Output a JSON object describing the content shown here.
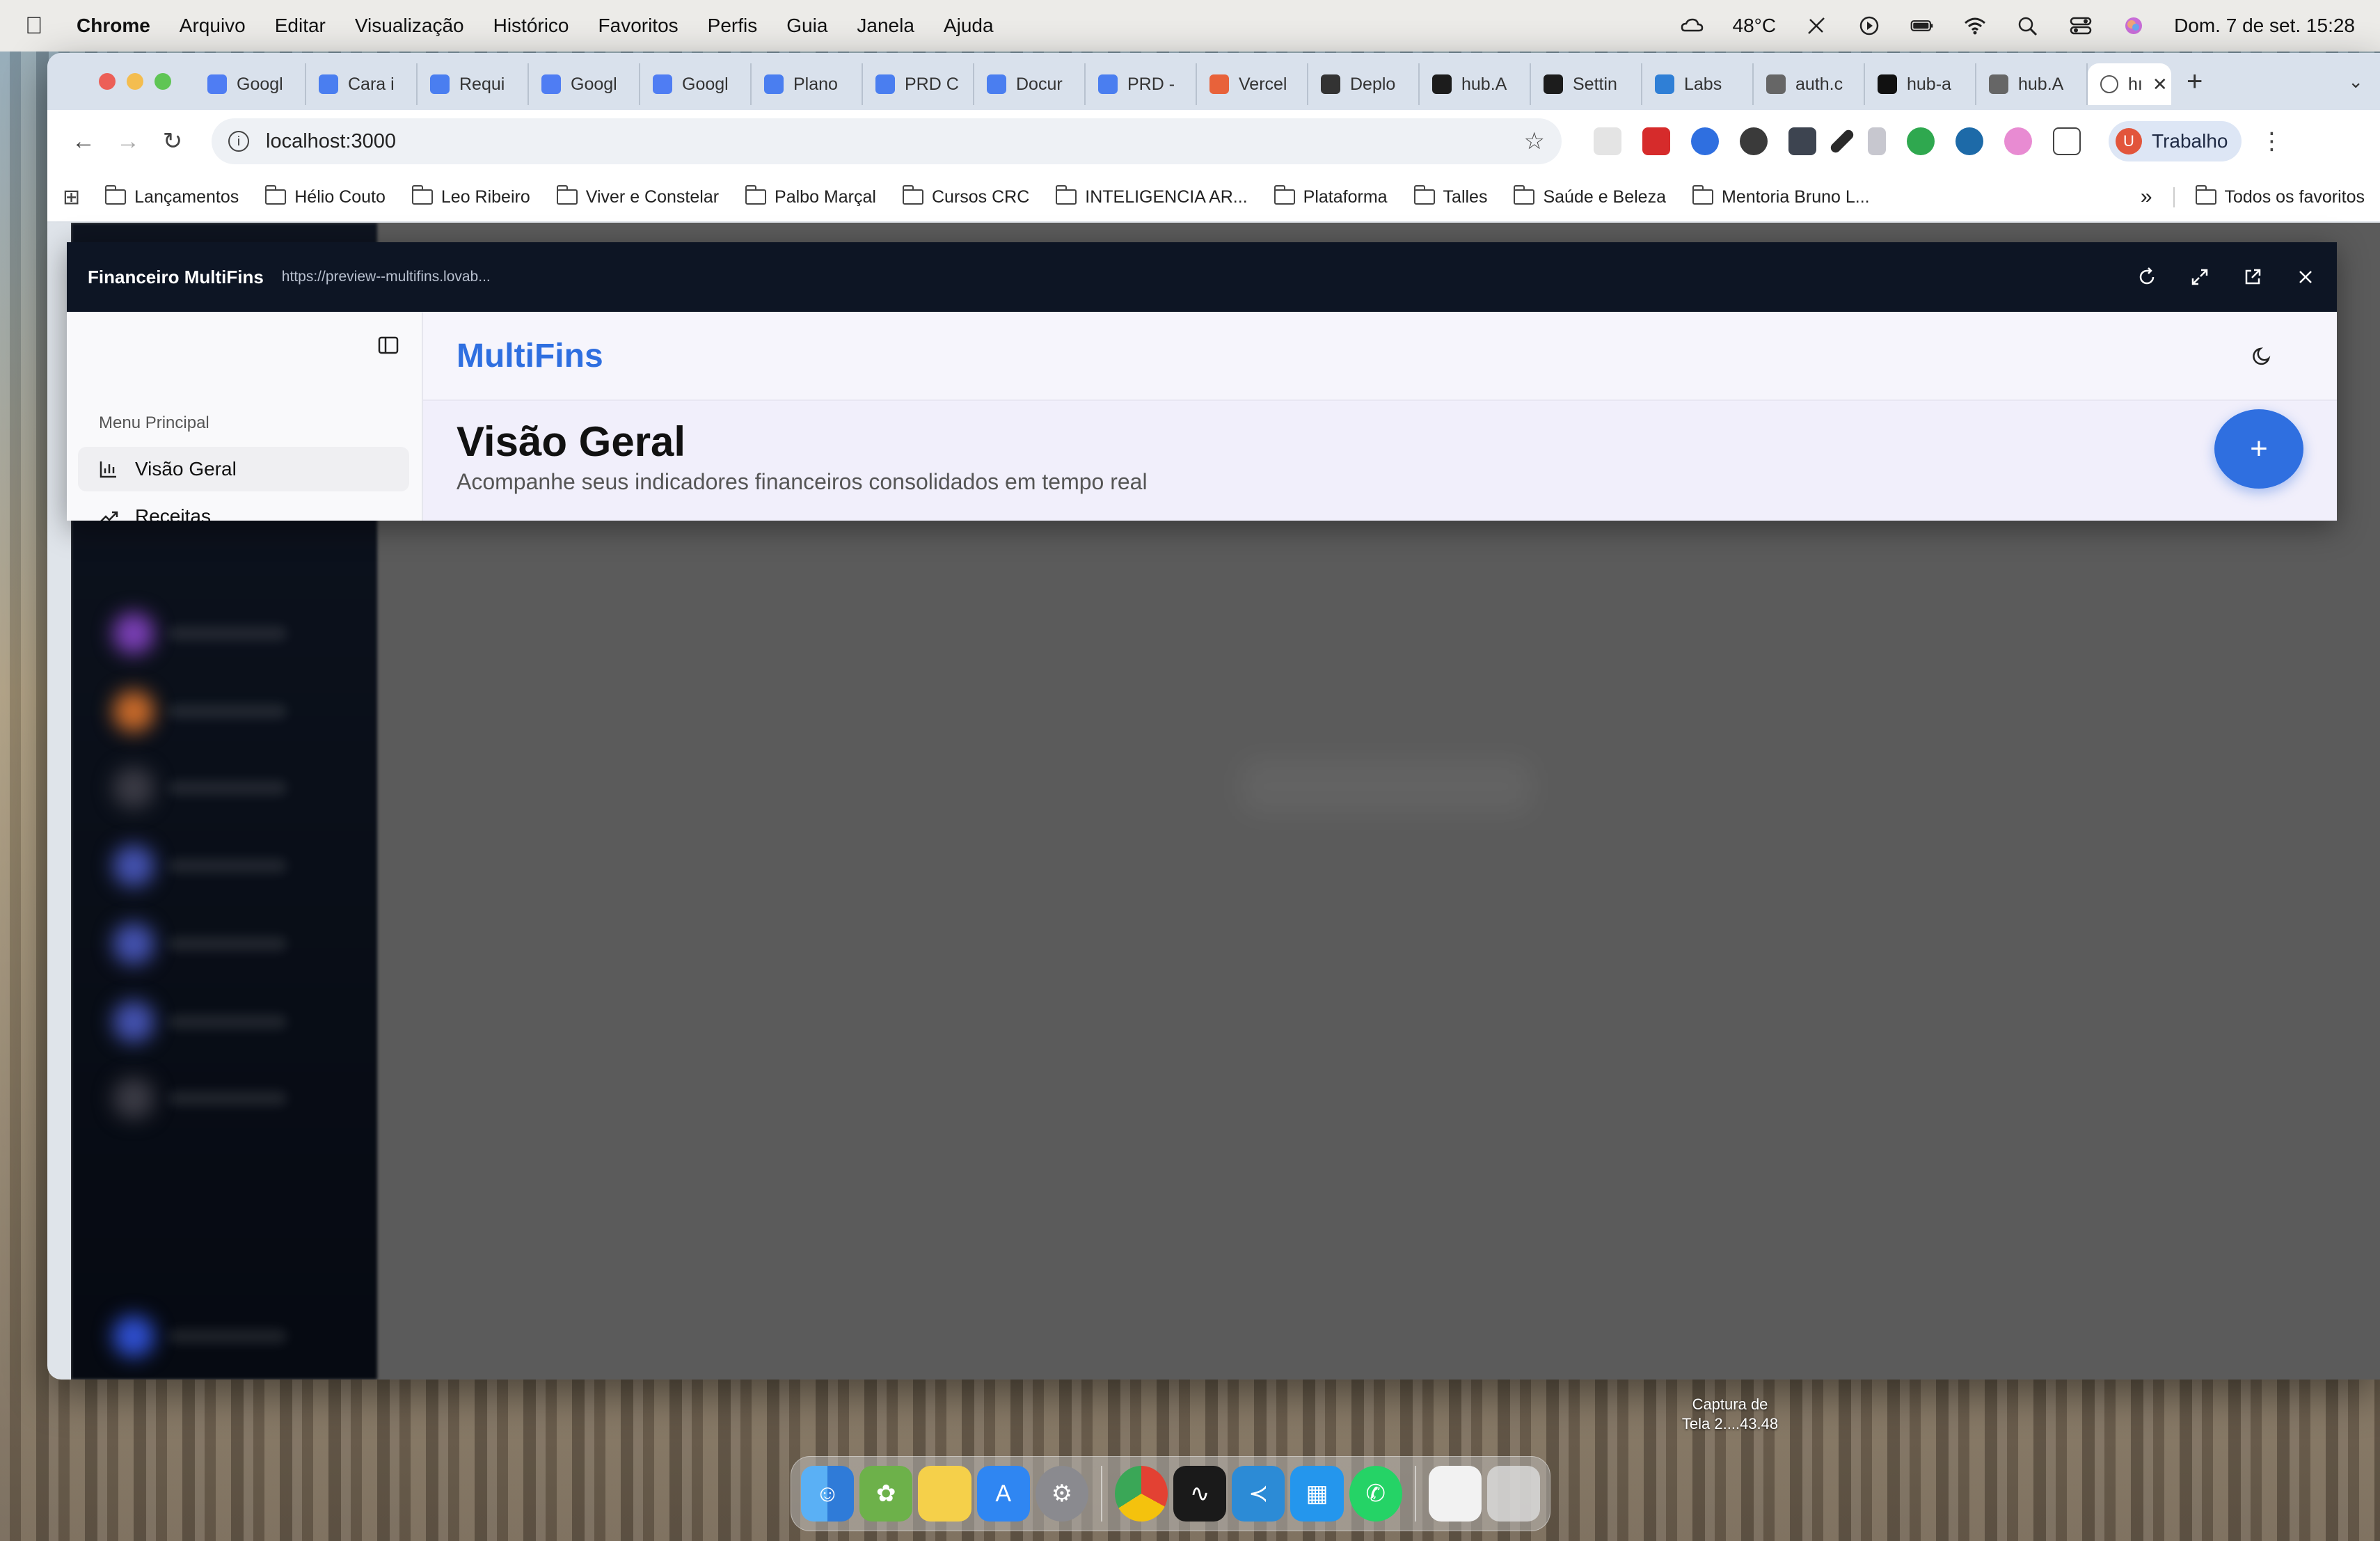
{
  "menubar": {
    "app": "Chrome",
    "items": [
      "Arquivo",
      "Editar",
      "Visualização",
      "Histórico",
      "Favoritos",
      "Perfis",
      "Guia",
      "Janela",
      "Ajuda"
    ],
    "temperature": "48°C",
    "datetime": "Dom. 7 de set.  15:28"
  },
  "tabs": [
    {
      "label": "Googl",
      "icon": "gemini-icon",
      "color": "#4f7df3"
    },
    {
      "label": "Cara i",
      "icon": "docs-icon",
      "color": "#4a7ef0"
    },
    {
      "label": "Requi",
      "icon": "docs-icon",
      "color": "#4a7ef0"
    },
    {
      "label": "Googl",
      "icon": "gemini-icon",
      "color": "#4f7df3"
    },
    {
      "label": "Googl",
      "icon": "gemini-icon",
      "color": "#4f7df3"
    },
    {
      "label": "Plano",
      "icon": "docs-icon",
      "color": "#4a7ef0"
    },
    {
      "label": "PRD C",
      "icon": "docs-icon",
      "color": "#4a7ef0"
    },
    {
      "label": "Docur",
      "icon": "docs-icon",
      "color": "#4a7ef0"
    },
    {
      "label": "PRD -",
      "icon": "docs-icon",
      "color": "#4a7ef0"
    },
    {
      "label": "Vercel",
      "icon": "spark-icon",
      "color": "#e8623a"
    },
    {
      "label": "Deplo",
      "icon": "robot-icon",
      "color": "#333333"
    },
    {
      "label": "hub.A",
      "icon": "pulse-icon",
      "color": "#1c1c1c"
    },
    {
      "label": "Settin",
      "icon": "pulse-icon",
      "color": "#1c1c1c"
    },
    {
      "label": "Labs",
      "icon": "docker-icon",
      "color": "#2f7fd6"
    },
    {
      "label": "auth.c",
      "icon": "globe-icon",
      "color": "#666666"
    },
    {
      "label": "hub-a",
      "icon": "triangle-icon",
      "color": "#111111"
    },
    {
      "label": "hub.A",
      "icon": "globe-icon",
      "color": "#666666"
    }
  ],
  "active_tab": {
    "label": "hı",
    "icon": "globe-icon"
  },
  "address": {
    "url": "localhost:3000"
  },
  "profile": {
    "initial": "U",
    "label": "Trabalho"
  },
  "bookmarks": [
    "Lançamentos",
    "Hélio Couto",
    "Leo Ribeiro",
    "Viver e Constelar",
    "Palbo Marçal",
    "Cursos CRC",
    "INTELIGENCIA AR...",
    "Plataforma",
    "Talles",
    "Saúde e Beleza",
    "Mentoria Bruno L..."
  ],
  "bookmarks_all": "Todos os favoritos",
  "preview": {
    "title": "Financeiro MultiFins",
    "url": "https://preview--multifins.lovab..."
  },
  "app": {
    "brand": "MultiFins",
    "menu_label": "Menu Principal",
    "nav": [
      {
        "label": "Visão Geral",
        "icon": "bar-chart-icon",
        "active": true
      },
      {
        "label": "Receitas",
        "icon": "trending-up-icon",
        "active": false
      }
    ],
    "page_title": "Visão Geral",
    "page_subtitle": "Acompanhe seus indicadores financeiros consolidados em tempo real",
    "fab_label": "+",
    "accent": "#2f6fe0"
  },
  "screenshot_label": [
    "Captura de",
    "Tela 2....43.48"
  ]
}
